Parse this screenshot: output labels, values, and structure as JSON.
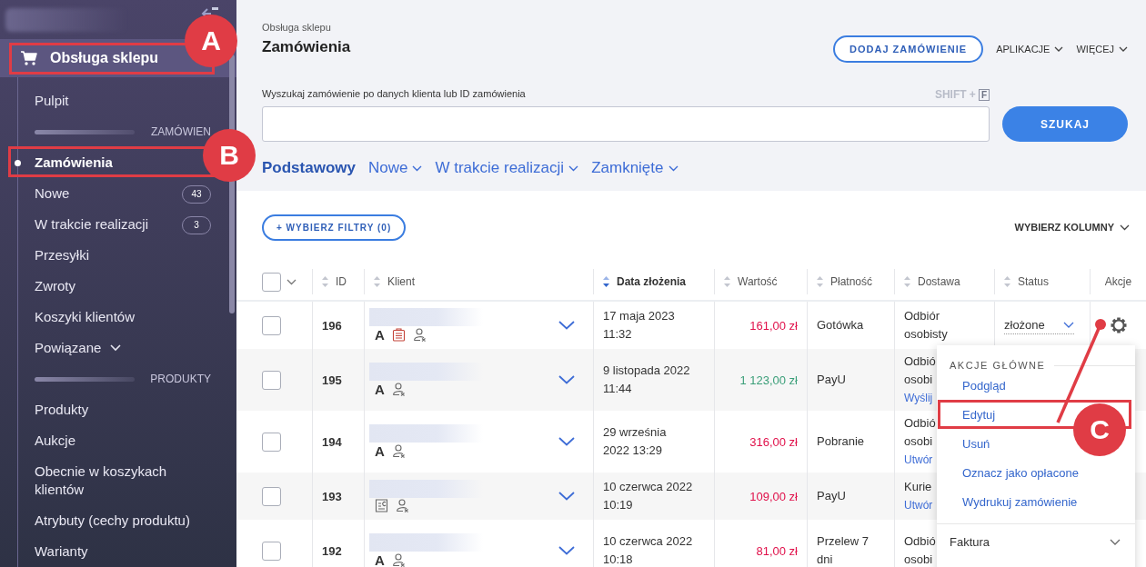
{
  "sidebar": {
    "section": {
      "label": "Obsługa sklepu",
      "callout": "A"
    },
    "items": [
      {
        "kind": "link",
        "label": "Pulpit",
        "selected": false
      },
      {
        "kind": "heading",
        "label": "ZAMÓWIEN"
      },
      {
        "kind": "link",
        "label": "Zamówienia",
        "selected": true,
        "callout": "B"
      },
      {
        "kind": "link",
        "label": "Nowe",
        "selected": false,
        "badge": "43"
      },
      {
        "kind": "link",
        "label": "W trakcie realizacji",
        "selected": false,
        "badge": "3"
      },
      {
        "kind": "link",
        "label": "Przesyłki",
        "selected": false
      },
      {
        "kind": "link",
        "label": "Zwroty",
        "selected": false
      },
      {
        "kind": "link",
        "label": "Koszyki klientów",
        "selected": false
      },
      {
        "kind": "group",
        "label": "Powiązane",
        "selected": false,
        "expanded": false
      },
      {
        "kind": "heading",
        "label": "PRODUKTY"
      },
      {
        "kind": "link",
        "label": "Produkty",
        "selected": false
      },
      {
        "kind": "link",
        "label": "Aukcje",
        "selected": false
      },
      {
        "kind": "link",
        "label": "Obecnie w koszykach klientów",
        "selected": false
      },
      {
        "kind": "link",
        "label": "Atrybuty (cechy produktu)",
        "selected": false
      },
      {
        "kind": "link",
        "label": "Warianty",
        "selected": false
      }
    ]
  },
  "header": {
    "breadcrumb": "Obsługa sklepu",
    "title": "Zamówienia",
    "add_button": "DODAJ ZAMÓWIENIE",
    "menus": [
      "APLIKACJE",
      "WIĘCEJ"
    ]
  },
  "search": {
    "label": "Wyszukaj zamówienie po danych klienta lub ID zamówienia",
    "shortcut": "SHIFT +",
    "shortcut_key": "F",
    "button": "SZUKAJ"
  },
  "tabs": [
    {
      "label": "Podstawowy",
      "selected": true,
      "dropdown": false
    },
    {
      "label": "Nowe",
      "selected": false,
      "dropdown": true
    },
    {
      "label": "W trakcie realizacji",
      "selected": false,
      "dropdown": true
    },
    {
      "label": "Zamknięte",
      "selected": false,
      "dropdown": true
    }
  ],
  "filters": {
    "button": "+ WYBIERZ FILTRY (0)",
    "columns_button": "WYBIERZ KOLUMNY"
  },
  "table": {
    "all_checked": false,
    "columns": [
      {
        "label": "ID",
        "sortable": true,
        "sorted": false
      },
      {
        "label": "Klient",
        "sortable": true,
        "sorted": false
      },
      {
        "label": "Data złożenia",
        "sortable": true,
        "sorted": true
      },
      {
        "label": "Wartość",
        "sortable": true,
        "sorted": false
      },
      {
        "label": "Płatność",
        "sortable": true,
        "sorted": false
      },
      {
        "label": "Dostawa",
        "sortable": true,
        "sorted": false
      },
      {
        "label": "Status",
        "sortable": true,
        "sorted": false
      },
      {
        "label": "Akcje",
        "sortable": false,
        "sorted": false
      }
    ],
    "rows": [
      {
        "checked": false,
        "id": "196",
        "icons": [
          {
            "kind": "letter",
            "text": "A"
          },
          {
            "kind": "document"
          },
          {
            "kind": "person"
          }
        ],
        "expanded": false,
        "date": [
          "17 maja 2023",
          "11:32"
        ],
        "value": "161,00 zł",
        "paid": false,
        "payment": "Gotówka",
        "delivery": [
          "Odbiór",
          "osobisty"
        ],
        "status": "złożone"
      },
      {
        "checked": false,
        "id": "195",
        "icons": [
          {
            "kind": "letter",
            "text": "A"
          },
          {
            "kind": "person"
          }
        ],
        "expanded": false,
        "date": [
          "9 listopada 2022",
          "11:44"
        ],
        "value": "1 123,00 zł",
        "paid": true,
        "payment": "PayU",
        "delivery": [
          "Odbió",
          "osobi"
        ],
        "delivery_link": "Wyślij"
      },
      {
        "checked": false,
        "id": "194",
        "icons": [
          {
            "kind": "letter",
            "text": "A"
          },
          {
            "kind": "person"
          }
        ],
        "expanded": false,
        "date": [
          "29 września",
          "2022 13:29"
        ],
        "value": "316,00 zł",
        "paid": false,
        "payment": "Pobranie",
        "delivery": [
          "Odbió",
          "osobi"
        ],
        "delivery_link": "Utwór"
      },
      {
        "checked": false,
        "id": "193",
        "icons": [
          {
            "kind": "invoice"
          },
          {
            "kind": "person"
          }
        ],
        "expanded": false,
        "date": [
          "10 czerwca 2022",
          "10:19"
        ],
        "value": "109,00 zł",
        "paid": false,
        "payment": "PayU",
        "delivery": [
          "Kurie"
        ],
        "delivery_link": "Utwór"
      },
      {
        "checked": false,
        "id": "192",
        "icons": [
          {
            "kind": "letter",
            "text": "A"
          },
          {
            "kind": "person"
          }
        ],
        "expanded": false,
        "date": [
          "10 czerwca 2022",
          "10:18"
        ],
        "value": "81,00 zł",
        "paid": false,
        "payment": "Przelew 7 dni",
        "delivery": [
          "Odbió",
          "osobi"
        ]
      }
    ]
  },
  "action_menu": {
    "heading": "AKCJE GŁÓWNE",
    "items": [
      {
        "label": "Podgląd"
      },
      {
        "label": "Edytuj",
        "callout": "C"
      },
      {
        "label": "Usuń"
      },
      {
        "label": "Oznacz jako opłacone"
      },
      {
        "label": "Wydrukuj zamówienie"
      }
    ],
    "section": {
      "label": "Faktura",
      "expanded": false
    }
  }
}
